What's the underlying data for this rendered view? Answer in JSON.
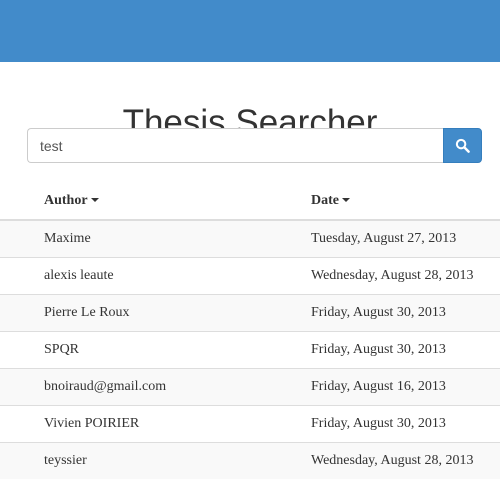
{
  "header": {
    "title": "Thesis Searcher"
  },
  "search": {
    "value": "test",
    "button_icon": "search-icon"
  },
  "table": {
    "columns": [
      {
        "label": "Author",
        "icon": "caret-down-icon"
      },
      {
        "label": "Date",
        "icon": "caret-down-icon"
      }
    ],
    "rows": [
      {
        "author": "Maxime",
        "date": "Tuesday, August 27, 2013"
      },
      {
        "author": "alexis leaute",
        "date": "Wednesday, August 28, 2013"
      },
      {
        "author": "Pierre Le Roux",
        "date": "Friday, August 30, 2013"
      },
      {
        "author": "SPQR",
        "date": "Friday, August 30, 2013"
      },
      {
        "author": "bnoiraud@gmail.com",
        "date": "Friday, August 16, 2013"
      },
      {
        "author": "Vivien POIRIER",
        "date": "Friday, August 30, 2013"
      },
      {
        "author": "teyssier",
        "date": "Wednesday, August 28, 2013"
      }
    ]
  },
  "colors": {
    "brand": "#428bca",
    "stripe": "#f9f9f9",
    "border": "#dddddd"
  }
}
